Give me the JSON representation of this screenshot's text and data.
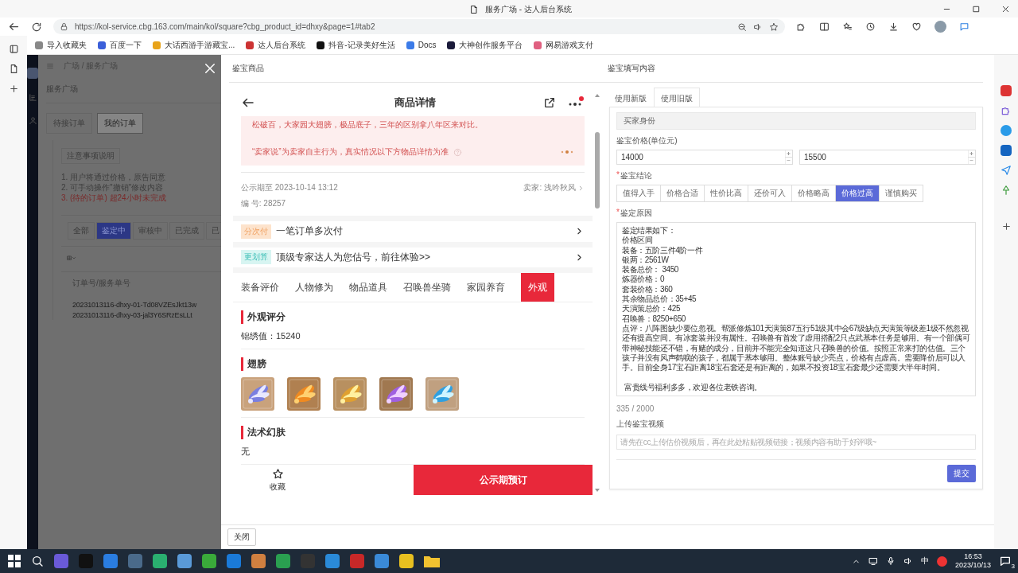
{
  "browser": {
    "tab_title": "服务广场 - 达人后台系统",
    "url": "https://kol-service.cbg.163.com/main/kol/square?cbg_product_id=dhxy&page=1#tab2",
    "bookmarks": [
      "导入收藏夹",
      "百度一下",
      "大话西游手游藏宝...",
      "达人后台系统",
      "抖音-记录美好生活",
      "Docs",
      "大神创作服务平台",
      "网易游戏支付"
    ]
  },
  "background_app": {
    "breadcrumb": "广场 / 服务广场",
    "title": "服务广场",
    "tabs": [
      {
        "label": "待接订单",
        "selected": false
      },
      {
        "label": "我的订单",
        "selected": true
      }
    ],
    "notice_title": "注意事项说明",
    "notices": [
      {
        "text": "1. 用户将通过价格，原告同意",
        "warning": false
      },
      {
        "text": "2. 可手动操作\"撤销\"修改内容",
        "warning": false
      },
      {
        "text": "3. (待的订单) 超24小时未完成",
        "warning": true
      }
    ],
    "filters": [
      {
        "label": "全部",
        "selected": false
      },
      {
        "label": "鉴定中",
        "selected": true
      },
      {
        "label": "审核中",
        "selected": false
      },
      {
        "label": "已完成",
        "selected": false
      },
      {
        "label": "已",
        "selected": false
      }
    ],
    "column": "订单号/服务单号",
    "orders": [
      "20231013116-dhxy-01-Td08VZEsJkt13w",
      "20231013116-dhxy-03-jal3Y6SRzEsLLt"
    ]
  },
  "drawer": {
    "left_title": "鉴宝商品",
    "right_title": "鉴宝填写内容",
    "close_button": "关闭"
  },
  "product": {
    "title": "商品详情",
    "seller_note": "松破百，大家园大翅膀，极品底子，三年的区别拿八年区来对比。",
    "disclaimer": "“卖家说”为卖家自主行为，真实情况以下方物品详情为准",
    "deadline": "公示期至 2023-10-14 13:12",
    "serial": "编 号: 28257",
    "seller": "卖家: 浅吟秋风",
    "promos": [
      {
        "tag": "分次付",
        "text": "一笔订单多次付",
        "kind": "installment"
      },
      {
        "tag": "更划算",
        "text": "顶级专家达人为您估号，前往体验>>",
        "kind": "deal"
      }
    ],
    "tabs": [
      {
        "label": "装备评价",
        "selected": false
      },
      {
        "label": "人物修为",
        "selected": false
      },
      {
        "label": "物品道具",
        "selected": false
      },
      {
        "label": "召唤兽坐骑",
        "selected": false
      },
      {
        "label": "家园养育",
        "selected": false
      },
      {
        "label": "外观",
        "selected": true
      }
    ],
    "sections": [
      {
        "title": "外观评分",
        "kind": "text",
        "value": "锦绣值：15240"
      },
      {
        "title": "翅膀",
        "kind": "gallery"
      },
      {
        "title": "法术幻肤",
        "kind": "text",
        "value": "无"
      }
    ],
    "favorite": "收藏",
    "reserve_button": "公示期预订"
  },
  "form": {
    "tabs": [
      {
        "label": "使用新版",
        "selected": false
      },
      {
        "label": "使用旧版",
        "selected": true
      }
    ],
    "section": "买家身份",
    "price_label": "鉴宝价格(单位元)",
    "price_min": "14000",
    "price_max": "15500",
    "conclusion_mark": "*",
    "conclusion_label": "鉴宝结论",
    "conclusions": [
      {
        "label": "值得入手",
        "selected": false
      },
      {
        "label": "价格合适",
        "selected": false
      },
      {
        "label": "性价比高",
        "selected": false
      },
      {
        "label": "还价可入",
        "selected": false
      },
      {
        "label": "价格略高",
        "selected": false
      },
      {
        "label": "价格过高",
        "selected": true
      },
      {
        "label": "谨慎购买",
        "selected": false
      }
    ],
    "reason_mark": "*",
    "reason_label": "鉴定原因",
    "reason_lines": [
      "鉴定结果如下：",
      "价格区间",
      "装备：五阶三件4阶一件",
      "银两：2561W",
      "装备总价： 3450",
      "炼器价格：0",
      "套装价格：360",
      "其余物品总价：35+45",
      "天演策总价：425",
      "召唤兽：8250+650",
      "点评：八阵图缺少要位忽视。帮派修炼101天演策87五行51级其中会67级缺点天演策等级差1级不然忽视还有提高空间。有冰套装并没有属性。召唤兽有首发了虚用搭配2只点武基本任务是够用。有一个部偶可带神秘技能还不错，有赌的成分，目前并不能完全知道这只召唤兽的价值。按照正常来打的估值。三个孩子并没有风声鹤唳的孩子，都属于基本够用。整体账号缺少亮点，价格有点虚高。需要降价后可以入手。目前全身17宝石距离18宝石套还是有距离的，如果不投资18宝石套最少还需要大半年时间。",
      "富贵线号福利多多，欢迎各位老铁咨询。"
    ],
    "count": "335 / 2000",
    "video_label": "上传鉴宝视频",
    "video_placeholder": "请先在cc上传估价视频后，再在此处粘贴视频链接；视频内容有助于好评哦~",
    "submit": "提交"
  },
  "taskbar": {
    "ime": "中",
    "time": "16:53",
    "date": "2023/10/13",
    "notifications": "3"
  }
}
